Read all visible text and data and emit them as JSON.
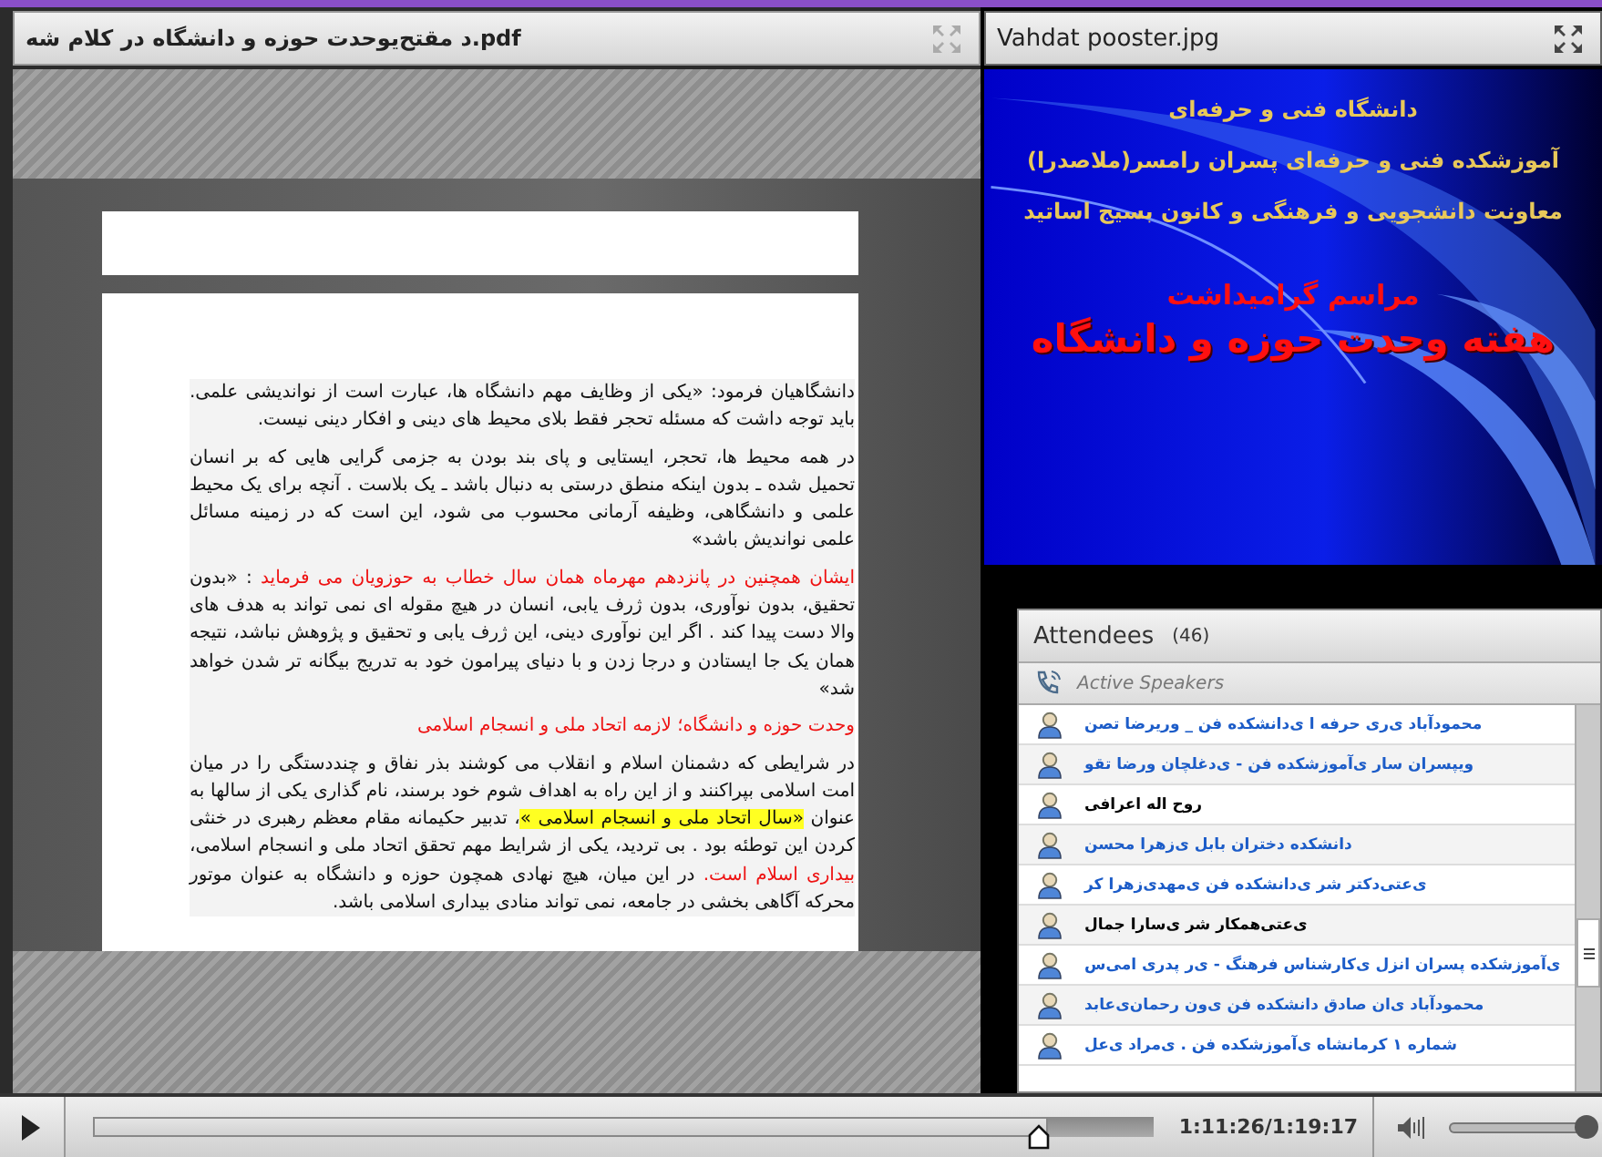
{
  "document_pod": {
    "title": "د مقتح‌یوحدت حوزه و دانشگاه در کلام شه.pdf",
    "paragraphs": [
      {
        "segments": [
          {
            "kind": "plain",
            "text": "دانشگاهیان فرمود: «یکی از وظایف مهم دانشگاه ها، عبارت است از نواندیشی علمی. باید توجه داشت که مسئله تحجر فقط بلای محیط های دینی و افکار دینی نیست."
          }
        ]
      },
      {
        "segments": [
          {
            "kind": "plain",
            "text": "در همه محیط ها، تحجر، ایستایی و پای بند بودن به جزمی گرایی هایی که بر انسان تحمیل شده ـ بدون اینکه منطق درستی به دنبال باشد ـ یک بلاست . آنچه برای یک محیط علمی و دانشگاهی، وظیفه آرمانی محسوب می شود، این است که در زمینه مسائل علمی نواندیش باشد»"
          }
        ]
      },
      {
        "segments": [
          {
            "kind": "red",
            "text": "ایشان همچنین در پانزدهم مهرماه همان سال خطاب به حوزویان می فرماید"
          },
          {
            "kind": "plain",
            "text": " : "
          },
          {
            "kind": "plain",
            "text": "«بدون تحقیق، بدون نوآوری، بدون ژرف یابی، انسان در هیچ مقوله ای نمی تواند به هدف های والا دست پیدا کند . اگر این نوآوری دینی، این ژرف یابی و تحقیق و پژوهش نباشد، نتیجه همان یک جا ایستادن و درجا زدن و با دنیای پیرامون خود به تدریج بیگانه تر شدن خواهد شد»"
          }
        ]
      },
      {
        "segments": [
          {
            "kind": "red",
            "text": "وحدت حوزه و دانشگاه؛ لازمه اتحاد ملی و انسجام اسلامی"
          }
        ]
      },
      {
        "segments": [
          {
            "kind": "plain",
            "text": "در شرایطی که دشمنان اسلام و انقلاب می کوشند بذر نفاق و چنددستگی را در میان امت اسلامی بپراکنند و از این راه به اهداف شوم خود برسند، نام گذاری یکی از سالها به عنوان "
          },
          {
            "kind": "highlight",
            "text": "«سال اتحاد ملی و انسجام اسلامی »"
          },
          {
            "kind": "plain",
            "text": "، تدبیر حکیمانه مقام معظم رهبری در خنثی کردن این توطئه بود . بی تردید، یکی از شرایط مهم تحقق اتحاد ملی و انسجام اسلامی، "
          },
          {
            "kind": "red",
            "text": "بیداری اسلام است."
          },
          {
            "kind": "plain",
            "text": " در این میان، هیچ نهادی همچون حوزه و دانشگاه به عنوان موتور محرکه آگاهی بخشی در جامعه، نمی تواند منادی بیداری اسلامی باشد."
          }
        ]
      }
    ]
  },
  "image_pod": {
    "title": "Vahdat pooster.jpg",
    "lines": [
      {
        "kind": "subtitle",
        "text": "دانشگاه فنی و حرفه‌ای"
      },
      {
        "kind": "subtitle",
        "text": "آموزشکده فنی و حرفه‌ای پسران رامسر(ملاصدرا)"
      },
      {
        "kind": "subtitle",
        "text": "معاونت دانشجویی و فرهنگی و کانون بسیج اساتید"
      },
      {
        "kind": "title",
        "text": "مراسم گرامیداشت"
      },
      {
        "kind": "headline",
        "text": "هفته وحدت حوزه و دانشگاه"
      }
    ]
  },
  "attendees": {
    "title": "Attendees",
    "count": "(46)",
    "section": "Active Speakers",
    "people": [
      {
        "name": "محمودآباد ی‌ری حرفه ا ی‌دانشکده فن _ وریرضا تصن",
        "color": "#1c5cc8"
      },
      {
        "name": "ویپسران سار ی‌آموزشکده فن - ی‌دغلچان ورضا تقو",
        "color": "#1c5cc8"
      },
      {
        "name": "روح اله اعرافی",
        "color": "#000000"
      },
      {
        "name": "دانشکده دختران بابل ی‌زهرا محسن",
        "color": "#1c5cc8"
      },
      {
        "name": "ی‌عتی‌دکتر شر ی‌دانشکده فن ی‌مهدی‌زهرا کر",
        "color": "#1c5cc8"
      },
      {
        "name": "ی‌عتی‌همکار شر ی‌سارا جمال",
        "color": "#000000"
      },
      {
        "name": "ی‌آموزشکده پسران انزل ی‌کارشناس فرهنگ - ی‌ر پدری امی‌س",
        "color": "#1c5cc8"
      },
      {
        "name": "محمودآباد ی‌ان صادق دانشکده فن ی‌ون رحمان‌ی‌عابد",
        "color": "#1c5cc8"
      },
      {
        "name": "شماره ۱ کرمانشاه ی‌آموزشکده فن . ی‌مراد ی‌عل",
        "color": "#1c5cc8"
      }
    ]
  },
  "player": {
    "time": "1:11:26/1:19:17",
    "progress": {
      "level": 0.9
    },
    "volume": {
      "level": 0.97
    }
  }
}
